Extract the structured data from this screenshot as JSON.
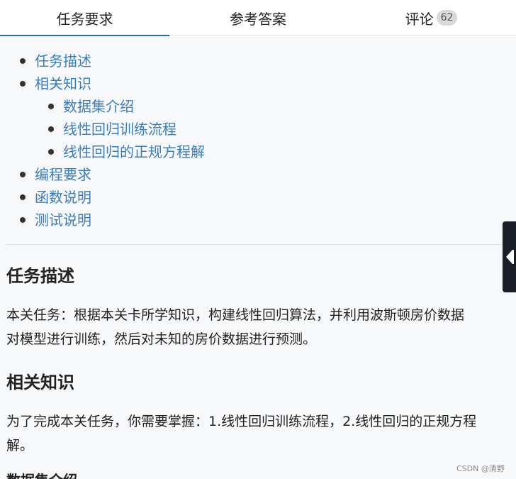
{
  "tabs": [
    {
      "label": "任务要求",
      "active": true
    },
    {
      "label": "参考答案",
      "active": false
    },
    {
      "label": "评论",
      "active": false,
      "badge": "62"
    }
  ],
  "toc": [
    {
      "label": "任务描述",
      "level": 1
    },
    {
      "label": "相关知识",
      "level": 1
    },
    {
      "label": "数据集介绍",
      "level": 2
    },
    {
      "label": "线性回归训练流程",
      "level": 2
    },
    {
      "label": "线性回归的正规方程解",
      "level": 2
    },
    {
      "label": "编程要求",
      "level": 1
    },
    {
      "label": "函数说明",
      "level": 1
    },
    {
      "label": "测试说明",
      "level": 1
    }
  ],
  "sections": {
    "task": {
      "heading": "任务描述",
      "line1": "本关任务：根据本关卡所学知识，构建线性回归算法，并利用波斯顿房价数据",
      "line2": "对模型进行训练，然后对未知的房价数据进行预测。"
    },
    "knowledge": {
      "heading": "相关知识",
      "line1": "为了完成本关任务，你需要掌握：1.线性回归训练流程，2.线性回归的正规方程",
      "line2": "解。"
    },
    "dataset": {
      "heading": "数据集介绍"
    }
  },
  "sidebar_toggle": {
    "icon": "triangle-left-icon"
  },
  "watermark": "CSDN @清野",
  "colors": {
    "accent": "#2a6fbb",
    "link": "#3a7dbf",
    "toggle_bg": "#1a1f27"
  }
}
